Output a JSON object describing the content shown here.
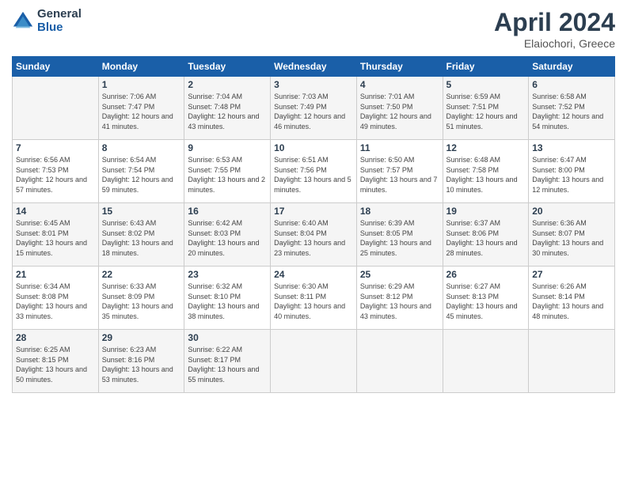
{
  "header": {
    "logo_line1": "General",
    "logo_line2": "Blue",
    "month": "April 2024",
    "location": "Elaiochori, Greece"
  },
  "weekdays": [
    "Sunday",
    "Monday",
    "Tuesday",
    "Wednesday",
    "Thursday",
    "Friday",
    "Saturday"
  ],
  "weeks": [
    [
      {
        "day": "",
        "sunrise": "",
        "sunset": "",
        "daylight": ""
      },
      {
        "day": "1",
        "sunrise": "Sunrise: 7:06 AM",
        "sunset": "Sunset: 7:47 PM",
        "daylight": "Daylight: 12 hours and 41 minutes."
      },
      {
        "day": "2",
        "sunrise": "Sunrise: 7:04 AM",
        "sunset": "Sunset: 7:48 PM",
        "daylight": "Daylight: 12 hours and 43 minutes."
      },
      {
        "day": "3",
        "sunrise": "Sunrise: 7:03 AM",
        "sunset": "Sunset: 7:49 PM",
        "daylight": "Daylight: 12 hours and 46 minutes."
      },
      {
        "day": "4",
        "sunrise": "Sunrise: 7:01 AM",
        "sunset": "Sunset: 7:50 PM",
        "daylight": "Daylight: 12 hours and 49 minutes."
      },
      {
        "day": "5",
        "sunrise": "Sunrise: 6:59 AM",
        "sunset": "Sunset: 7:51 PM",
        "daylight": "Daylight: 12 hours and 51 minutes."
      },
      {
        "day": "6",
        "sunrise": "Sunrise: 6:58 AM",
        "sunset": "Sunset: 7:52 PM",
        "daylight": "Daylight: 12 hours and 54 minutes."
      }
    ],
    [
      {
        "day": "7",
        "sunrise": "Sunrise: 6:56 AM",
        "sunset": "Sunset: 7:53 PM",
        "daylight": "Daylight: 12 hours and 57 minutes."
      },
      {
        "day": "8",
        "sunrise": "Sunrise: 6:54 AM",
        "sunset": "Sunset: 7:54 PM",
        "daylight": "Daylight: 12 hours and 59 minutes."
      },
      {
        "day": "9",
        "sunrise": "Sunrise: 6:53 AM",
        "sunset": "Sunset: 7:55 PM",
        "daylight": "Daylight: 13 hours and 2 minutes."
      },
      {
        "day": "10",
        "sunrise": "Sunrise: 6:51 AM",
        "sunset": "Sunset: 7:56 PM",
        "daylight": "Daylight: 13 hours and 5 minutes."
      },
      {
        "day": "11",
        "sunrise": "Sunrise: 6:50 AM",
        "sunset": "Sunset: 7:57 PM",
        "daylight": "Daylight: 13 hours and 7 minutes."
      },
      {
        "day": "12",
        "sunrise": "Sunrise: 6:48 AM",
        "sunset": "Sunset: 7:58 PM",
        "daylight": "Daylight: 13 hours and 10 minutes."
      },
      {
        "day": "13",
        "sunrise": "Sunrise: 6:47 AM",
        "sunset": "Sunset: 8:00 PM",
        "daylight": "Daylight: 13 hours and 12 minutes."
      }
    ],
    [
      {
        "day": "14",
        "sunrise": "Sunrise: 6:45 AM",
        "sunset": "Sunset: 8:01 PM",
        "daylight": "Daylight: 13 hours and 15 minutes."
      },
      {
        "day": "15",
        "sunrise": "Sunrise: 6:43 AM",
        "sunset": "Sunset: 8:02 PM",
        "daylight": "Daylight: 13 hours and 18 minutes."
      },
      {
        "day": "16",
        "sunrise": "Sunrise: 6:42 AM",
        "sunset": "Sunset: 8:03 PM",
        "daylight": "Daylight: 13 hours and 20 minutes."
      },
      {
        "day": "17",
        "sunrise": "Sunrise: 6:40 AM",
        "sunset": "Sunset: 8:04 PM",
        "daylight": "Daylight: 13 hours and 23 minutes."
      },
      {
        "day": "18",
        "sunrise": "Sunrise: 6:39 AM",
        "sunset": "Sunset: 8:05 PM",
        "daylight": "Daylight: 13 hours and 25 minutes."
      },
      {
        "day": "19",
        "sunrise": "Sunrise: 6:37 AM",
        "sunset": "Sunset: 8:06 PM",
        "daylight": "Daylight: 13 hours and 28 minutes."
      },
      {
        "day": "20",
        "sunrise": "Sunrise: 6:36 AM",
        "sunset": "Sunset: 8:07 PM",
        "daylight": "Daylight: 13 hours and 30 minutes."
      }
    ],
    [
      {
        "day": "21",
        "sunrise": "Sunrise: 6:34 AM",
        "sunset": "Sunset: 8:08 PM",
        "daylight": "Daylight: 13 hours and 33 minutes."
      },
      {
        "day": "22",
        "sunrise": "Sunrise: 6:33 AM",
        "sunset": "Sunset: 8:09 PM",
        "daylight": "Daylight: 13 hours and 35 minutes."
      },
      {
        "day": "23",
        "sunrise": "Sunrise: 6:32 AM",
        "sunset": "Sunset: 8:10 PM",
        "daylight": "Daylight: 13 hours and 38 minutes."
      },
      {
        "day": "24",
        "sunrise": "Sunrise: 6:30 AM",
        "sunset": "Sunset: 8:11 PM",
        "daylight": "Daylight: 13 hours and 40 minutes."
      },
      {
        "day": "25",
        "sunrise": "Sunrise: 6:29 AM",
        "sunset": "Sunset: 8:12 PM",
        "daylight": "Daylight: 13 hours and 43 minutes."
      },
      {
        "day": "26",
        "sunrise": "Sunrise: 6:27 AM",
        "sunset": "Sunset: 8:13 PM",
        "daylight": "Daylight: 13 hours and 45 minutes."
      },
      {
        "day": "27",
        "sunrise": "Sunrise: 6:26 AM",
        "sunset": "Sunset: 8:14 PM",
        "daylight": "Daylight: 13 hours and 48 minutes."
      }
    ],
    [
      {
        "day": "28",
        "sunrise": "Sunrise: 6:25 AM",
        "sunset": "Sunset: 8:15 PM",
        "daylight": "Daylight: 13 hours and 50 minutes."
      },
      {
        "day": "29",
        "sunrise": "Sunrise: 6:23 AM",
        "sunset": "Sunset: 8:16 PM",
        "daylight": "Daylight: 13 hours and 53 minutes."
      },
      {
        "day": "30",
        "sunrise": "Sunrise: 6:22 AM",
        "sunset": "Sunset: 8:17 PM",
        "daylight": "Daylight: 13 hours and 55 minutes."
      },
      {
        "day": "",
        "sunrise": "",
        "sunset": "",
        "daylight": ""
      },
      {
        "day": "",
        "sunrise": "",
        "sunset": "",
        "daylight": ""
      },
      {
        "day": "",
        "sunrise": "",
        "sunset": "",
        "daylight": ""
      },
      {
        "day": "",
        "sunrise": "",
        "sunset": "",
        "daylight": ""
      }
    ]
  ]
}
